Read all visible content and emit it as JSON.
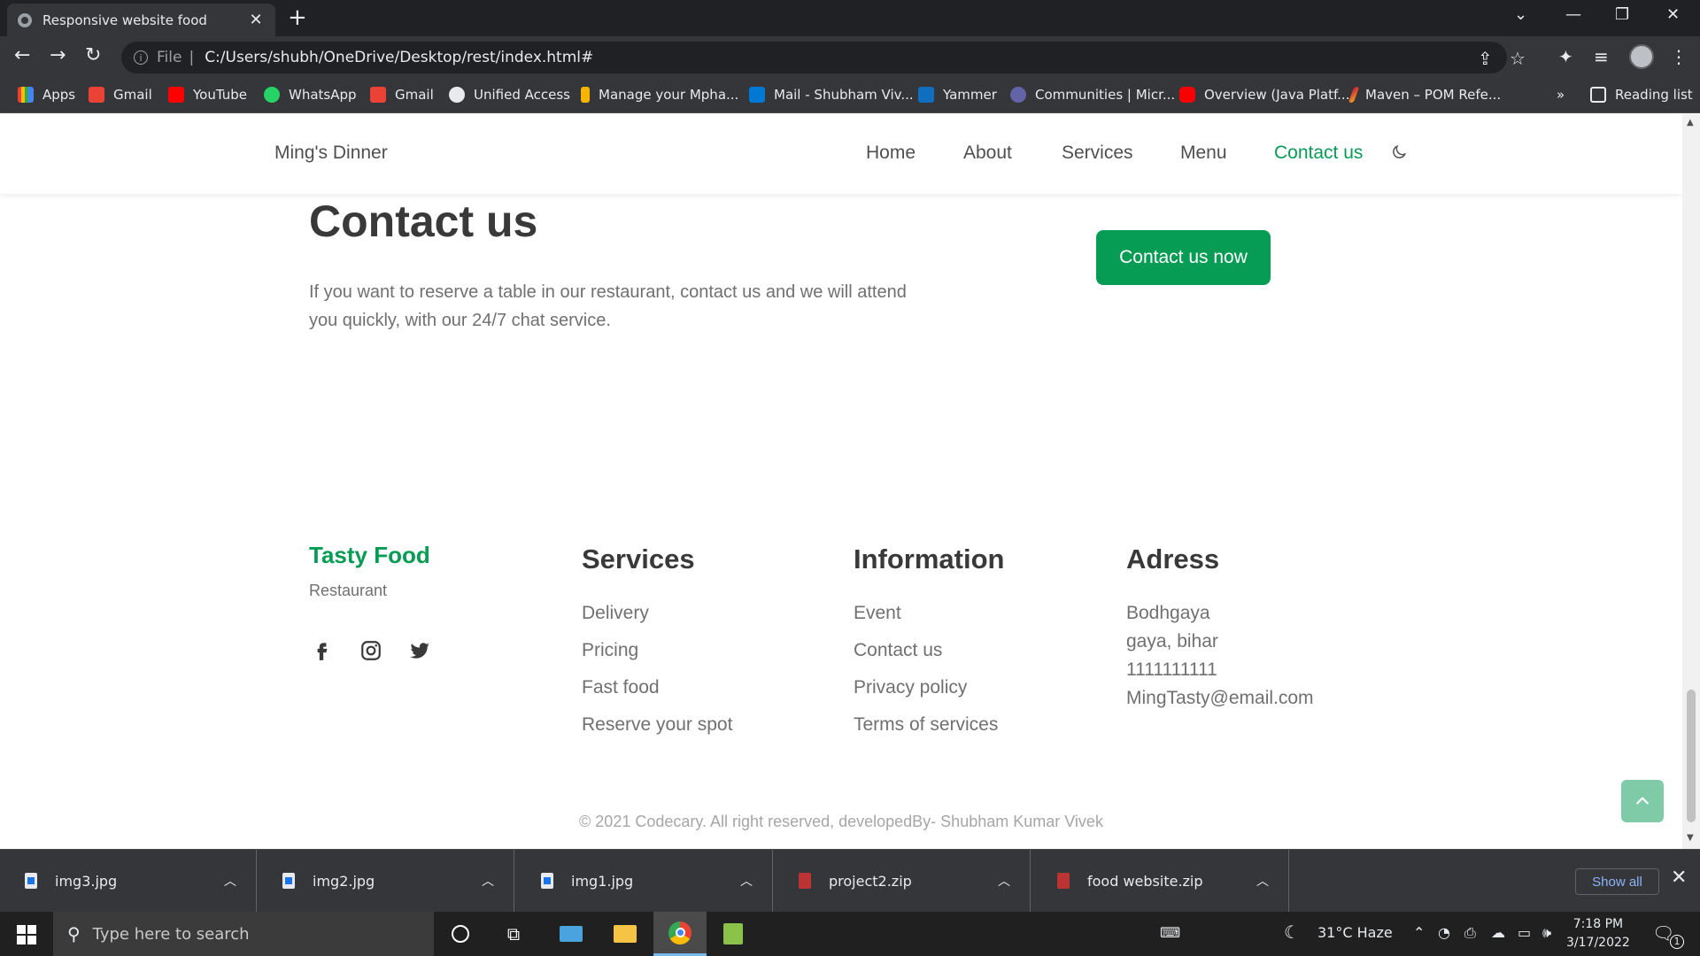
{
  "browser": {
    "tab_title": "Responsive website food",
    "url_scheme": "File",
    "url": "C:/Users/shubh/OneDrive/Desktop/rest/index.html#",
    "reading_list": "Reading list",
    "bookmarks": [
      "Apps",
      "Gmail",
      "YouTube",
      "WhatsApp",
      "Gmail",
      "Unified Access",
      "Manage your Mpha...",
      "Mail - Shubham Viv...",
      "Yammer",
      "Communities | Micr...",
      "Overview (Java Platf...",
      "Maven – POM Refe..."
    ],
    "bookmark_overflow": "»"
  },
  "site": {
    "logo": "Ming's Dinner",
    "nav": [
      "Home",
      "About",
      "Services",
      "Menu",
      "Contact us"
    ],
    "active_nav": "Contact us",
    "contact": {
      "title": "Contact us",
      "description": "If you want to reserve a table in our restaurant, contact us and we will attend you quickly, with our 24/7 chat service.",
      "button": "Contact us now"
    },
    "footer": {
      "brand": "Tasty Food",
      "subtitle": "Restaurant",
      "social_icons": [
        "facebook-icon",
        "instagram-icon",
        "twitter-icon"
      ],
      "services": {
        "title": "Services",
        "links": [
          "Delivery",
          "Pricing",
          "Fast food",
          "Reserve your spot"
        ]
      },
      "information": {
        "title": "Information",
        "links": [
          "Event",
          "Contact us",
          "Privacy policy",
          "Terms of services"
        ]
      },
      "address": {
        "title": "Adress",
        "lines": [
          "Bodhgaya",
          "gaya, bihar",
          "1111111111",
          "MingTasty@email.com"
        ]
      },
      "copyright": "© 2021 Codecary. All right reserved, developedBy- Shubham Kumar Vivek"
    },
    "colors": {
      "accent": "#069c54",
      "text": "#393939",
      "muted": "#707070"
    }
  },
  "downloads": {
    "items": [
      "img3.jpg",
      "img2.jpg",
      "img1.jpg",
      "project2.zip",
      "food website.zip"
    ],
    "show_all": "Show all"
  },
  "taskbar": {
    "search_placeholder": "Type here to search",
    "weather": "31°C  Haze",
    "time": "7:18 PM",
    "date": "3/17/2022",
    "notifications": "1"
  }
}
